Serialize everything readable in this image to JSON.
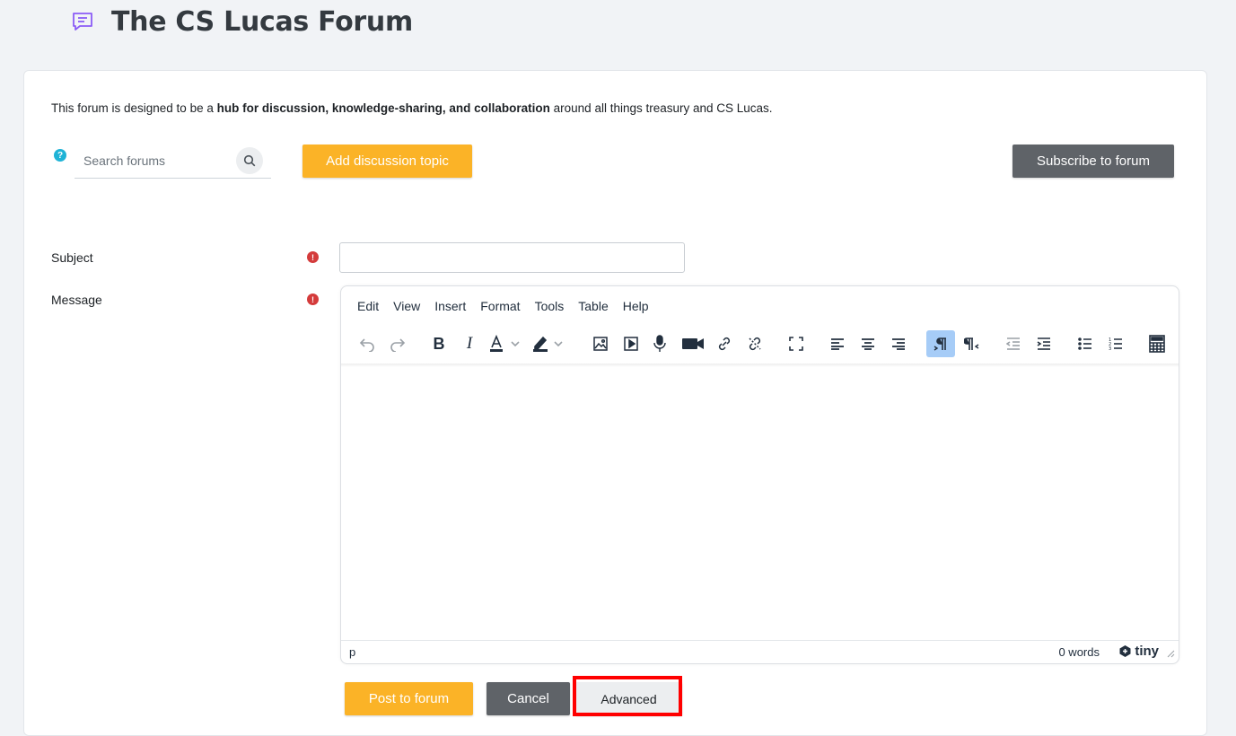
{
  "header": {
    "title": "The CS Lucas Forum",
    "icon": "chat-lines-icon",
    "icon_color": "#8b5cf6"
  },
  "intro": {
    "prefix": "This forum is designed to be a ",
    "bold": "hub for discussion, knowledge-sharing, and collaboration",
    "suffix": " around all things treasury and CS Lucas."
  },
  "search": {
    "placeholder": "Search forums",
    "help_symbol": "?"
  },
  "actions": {
    "add_topic": "Add discussion topic",
    "subscribe": "Subscribe to forum"
  },
  "form": {
    "subject_label": "Subject",
    "message_label": "Message",
    "required_symbol": "!"
  },
  "editor": {
    "menu": [
      "Edit",
      "View",
      "Insert",
      "Format",
      "Tools",
      "Table",
      "Help"
    ],
    "status_path": "p",
    "word_count": "0 words",
    "brand": "tiny"
  },
  "footer_buttons": {
    "post": "Post to forum",
    "cancel": "Cancel",
    "advanced": "Advanced"
  },
  "colors": {
    "primary": "#fbb327",
    "secondary": "#5f6368",
    "required": "#d43b3b",
    "help": "#1fb3d6",
    "highlight": "#ff0000"
  }
}
